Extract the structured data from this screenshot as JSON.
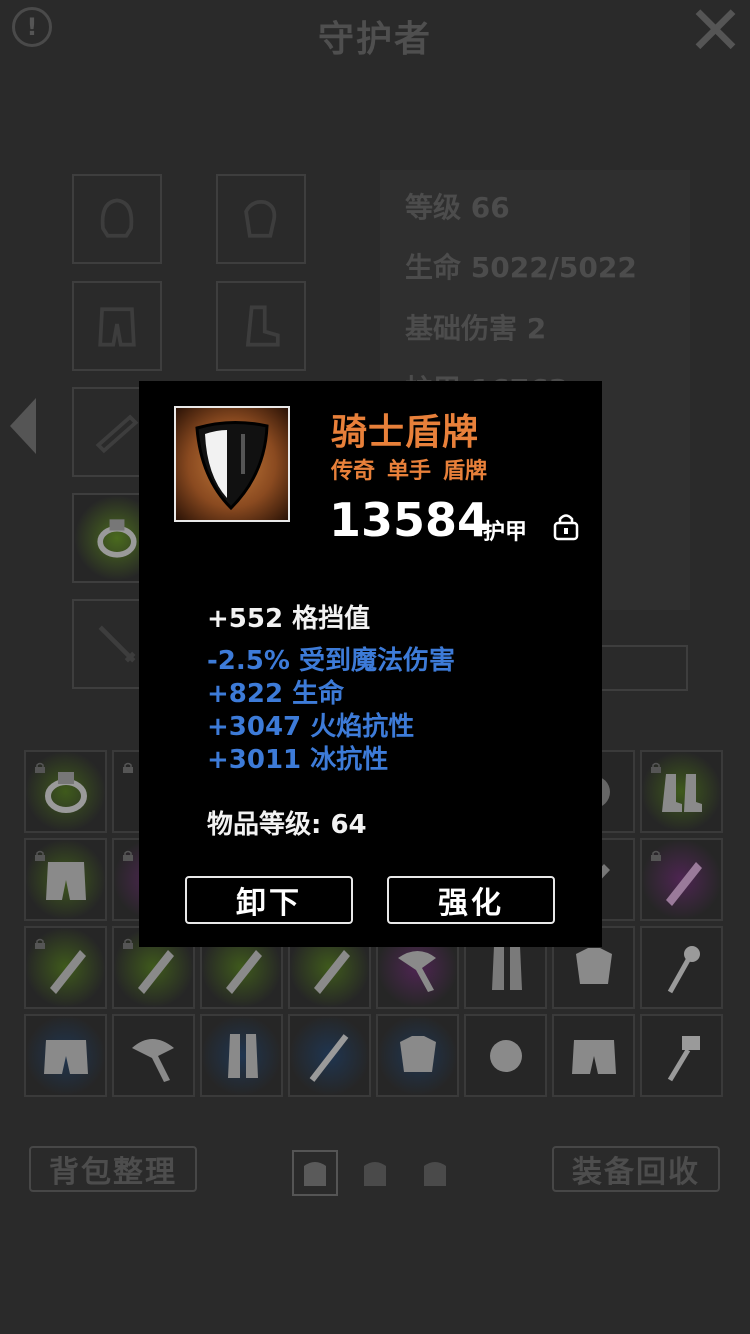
{
  "header": {
    "info_label": "!",
    "title": "守护者",
    "close_label": "✕"
  },
  "stats": {
    "level": "等级 66",
    "hp": "生命 5022/5022",
    "base_damage": "基础伤害 2",
    "armor_partial": "护甲 16763"
  },
  "bottom": {
    "sort_label": "背包整理",
    "recycle_label": "装备回收"
  },
  "popup": {
    "name": "骑士盾牌",
    "rarity": "传奇",
    "hand": "单手",
    "category": "盾牌",
    "armor_value": "13584",
    "armor_label": "护甲",
    "primary_attr": "+552 格挡值",
    "bonus_attrs": [
      "-2.5% 受到魔法伤害",
      "+822 生命",
      "+3047 火焰抗性",
      "+3011 冰抗性"
    ],
    "item_level": "物品等级: 64",
    "unequip_label": "卸下",
    "enhance_label": "强化"
  },
  "colors": {
    "legendary": "#e8803a",
    "bonus": "#3d7bd8",
    "uncommon_glow": "#4a6a1e",
    "epic_glow": "#5a2a5e",
    "rare_glow": "#1f3550"
  }
}
